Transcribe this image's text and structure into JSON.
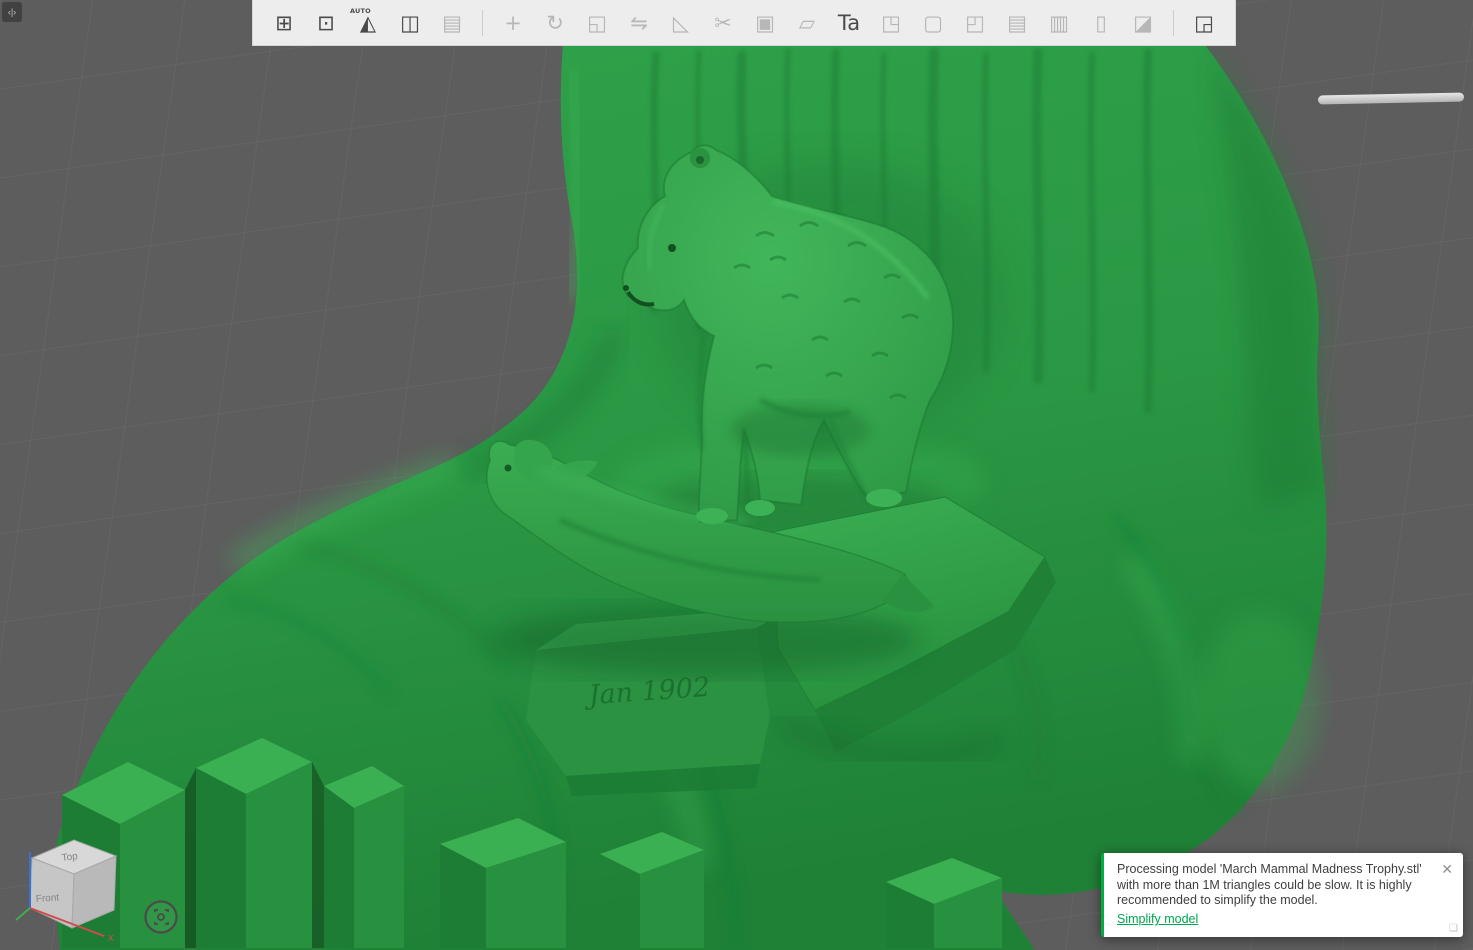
{
  "chrome": {
    "collapse_glyph": "‹|›",
    "grip_glyph": "❏"
  },
  "toolbar": {
    "groups": [
      {
        "items": [
          {
            "name": "add-object-icon",
            "glyph": "⊞",
            "enabled": true
          },
          {
            "name": "add-plate-icon",
            "glyph": "⊡",
            "enabled": true
          },
          {
            "name": "auto-orient-icon",
            "glyph": "◭",
            "enabled": true,
            "badge": "AUTO"
          },
          {
            "name": "arrange-icon",
            "glyph": "◫",
            "enabled": true
          },
          {
            "name": "variable-layer-icon",
            "glyph": "▤",
            "enabled": false
          }
        ]
      },
      {
        "items": [
          {
            "name": "move-icon",
            "glyph": "+",
            "enabled": false
          },
          {
            "name": "rotate-icon",
            "glyph": "↻",
            "enabled": false
          },
          {
            "name": "scale-icon",
            "glyph": "◱",
            "enabled": false
          },
          {
            "name": "mirror-icon",
            "glyph": "⇋",
            "enabled": false
          },
          {
            "name": "lay-on-face-icon",
            "glyph": "◺",
            "enabled": false
          },
          {
            "name": "cut-icon",
            "glyph": "✂",
            "enabled": false
          },
          {
            "name": "clone-icon",
            "glyph": "▣",
            "enabled": false
          },
          {
            "name": "skew-icon",
            "glyph": "▱",
            "enabled": false
          },
          {
            "name": "text-tool-icon",
            "glyph": "Ta",
            "enabled": true
          },
          {
            "name": "mesh-frame-icon",
            "glyph": "◳",
            "enabled": false
          },
          {
            "name": "cube-outline-icon",
            "glyph": "▢",
            "enabled": false
          },
          {
            "name": "expand-selection-icon",
            "glyph": "◰",
            "enabled": false
          },
          {
            "name": "stack-icon",
            "glyph": "▤",
            "enabled": false
          },
          {
            "name": "copy-icon",
            "glyph": "▥",
            "enabled": false
          },
          {
            "name": "process-icon",
            "glyph": "▯",
            "enabled": false
          },
          {
            "name": "eraser-icon",
            "glyph": "◪",
            "enabled": false
          }
        ]
      },
      {
        "items": [
          {
            "name": "assembly-view-icon",
            "glyph": "◲",
            "enabled": true
          }
        ]
      }
    ]
  },
  "viewport": {
    "background_color": "#5d5d5d",
    "grid_color": "#6c6c6c",
    "model_color": "#2ea44a"
  },
  "model": {
    "inscription": "Jan 1902"
  },
  "nav_cube": {
    "top_label": "Top",
    "front_label": "Front",
    "x_axis_label": "x"
  },
  "toast": {
    "message": "Processing model 'March Mammal Madness Trophy.stl' with more than 1M triangles could be slow. It is highly recommended to simplify the model.",
    "link_label": "Simplify model",
    "close_glyph": "✕",
    "accent_color": "#00ae42"
  }
}
